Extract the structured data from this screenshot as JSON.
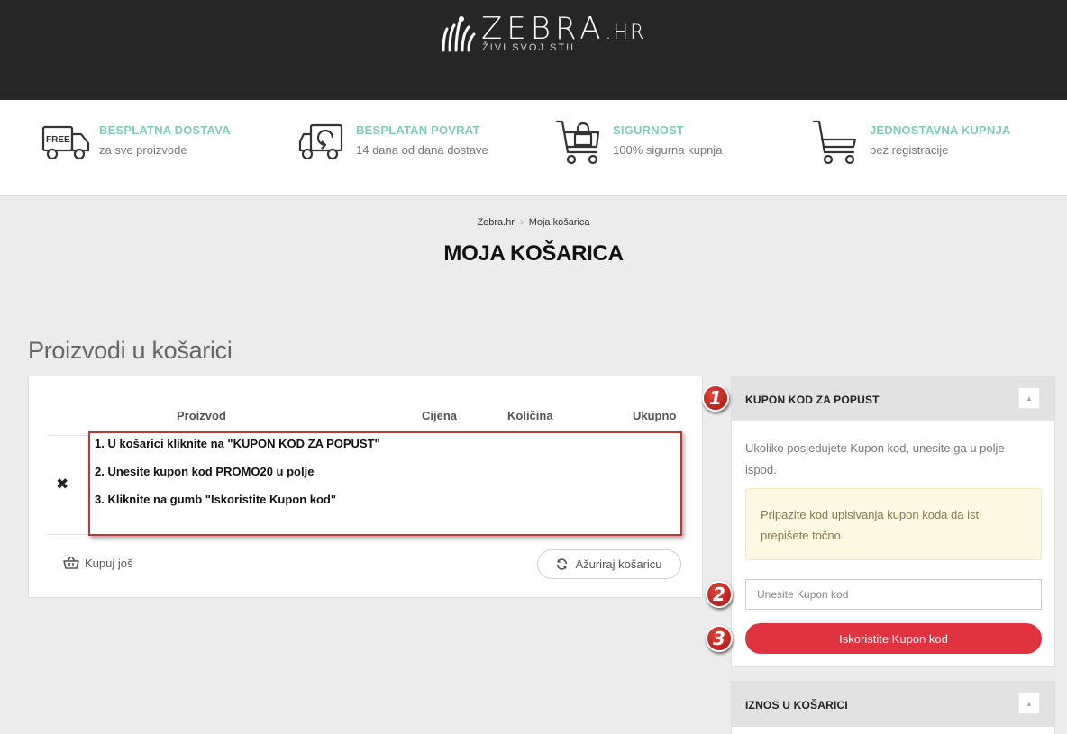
{
  "header": {
    "logo_text": "ZEBRA",
    "logo_tld": ".HR",
    "logo_tagline": "ŽIVI SVOJ STIL"
  },
  "features": [
    {
      "icon": "free-truck-icon",
      "badge": "FREE",
      "title": "BESPLATNA DOSTAVA",
      "subtitle": "za sve proizvode"
    },
    {
      "icon": "return-truck-icon",
      "title": "BESPLATAN POVRAT",
      "subtitle": "14 dana od dana dostave"
    },
    {
      "icon": "lock-cart-icon",
      "title": "SIGURNOST",
      "subtitle": "100% sigurna kupnja"
    },
    {
      "icon": "cart-icon",
      "title": "JEDNOSTAVNA KUPNJA",
      "subtitle": "bez registracije"
    }
  ],
  "breadcrumb": {
    "home": "Zebra.hr",
    "current": "Moja košarica"
  },
  "page_title": "MOJA KOŠARICA",
  "cart": {
    "section_title": "Proizvodi u košarici",
    "columns": {
      "product": "Proizvod",
      "price": "Cijena",
      "quantity": "Količina",
      "total": "Ukupno"
    },
    "remove_symbol": "✖",
    "continue_label": "Kupuj još",
    "update_label": "Ažuriraj košaricu"
  },
  "instructions": [
    "1. U košarici kliknite na \"KUPON KOD ZA POPUST\"",
    "2. Unesite kupon kod  PROMO20 u polje",
    "3. Kliknite na gumb \"Iskoristite Kupon kod\""
  ],
  "coupon": {
    "title": "KUPON KOD ZA POPUST",
    "description": "Ukoliko posjedujete Kupon kod, unesite ga u polje ispod.",
    "notice": "Pripazite kod upisivanja kupon koda da isti prepišete točno.",
    "input_placeholder": "Unesite Kupon kod",
    "button_label": "Iskoristite Kupon kod",
    "collapse_symbol": "▲"
  },
  "cart_total": {
    "title": "IZNOS U KOŠARICI",
    "collapse_symbol": "▲"
  },
  "markers": [
    "1",
    "2",
    "3"
  ],
  "colors": {
    "accent_green": "#7ecdb7",
    "button_red": "#e0323f",
    "marker_red": "#c7281f",
    "header_dark": "#262626"
  }
}
